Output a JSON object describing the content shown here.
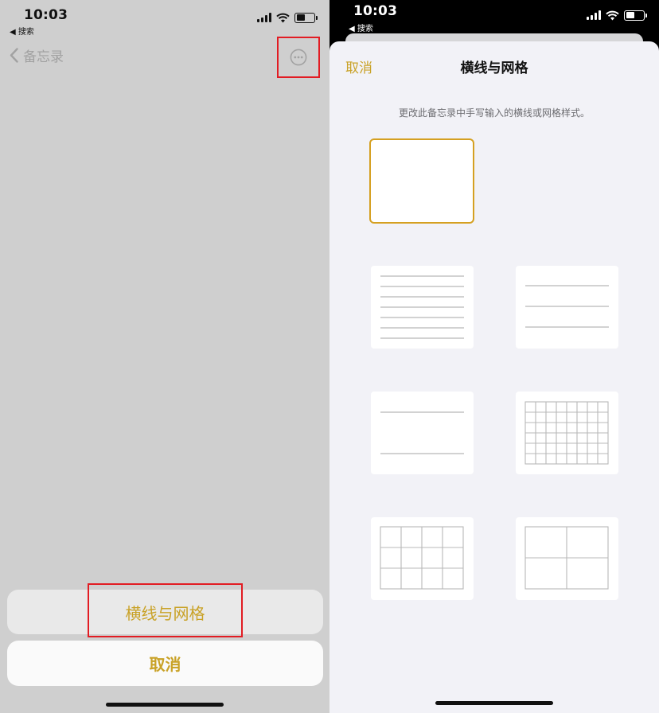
{
  "left": {
    "status": {
      "time": "10:03",
      "breadcrumb": "◀ 搜索"
    },
    "nav": {
      "back_label": "备忘录"
    },
    "sheet": {
      "action_label": "横线与网格",
      "cancel_label": "取消"
    }
  },
  "right": {
    "status": {
      "time": "10:03",
      "breadcrumb": "◀ 搜索"
    },
    "modal": {
      "cancel_label": "取消",
      "title": "横线与网格",
      "description": "更改此备忘录中手写输入的横线或网格样式。"
    },
    "options": [
      {
        "name": "blank",
        "selected": true
      },
      {
        "name": "small-lines",
        "selected": false
      },
      {
        "name": "medium-lines",
        "selected": false
      },
      {
        "name": "large-lines",
        "selected": false
      },
      {
        "name": "small-grid",
        "selected": false
      },
      {
        "name": "medium-grid",
        "selected": false
      },
      {
        "name": "large-grid",
        "selected": false
      }
    ]
  },
  "colors": {
    "accent": "#c9a227",
    "highlight_box": "#e21c23",
    "selected_border": "#d5a021",
    "line_stroke": "#b8b8b8"
  },
  "icons": [
    "signal-icon",
    "wifi-icon",
    "battery-icon",
    "chevron-left-icon",
    "more-ellipsis-icon"
  ]
}
